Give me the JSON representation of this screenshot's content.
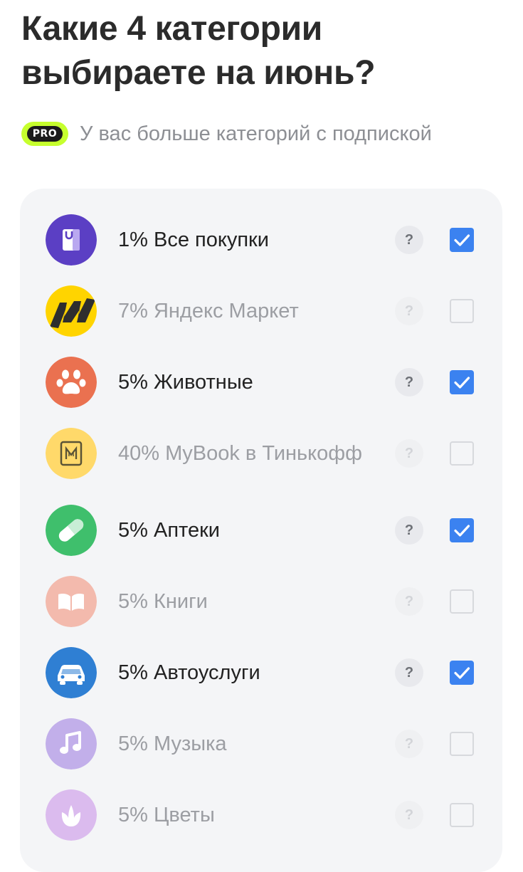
{
  "header": {
    "title": "Какие 4 категории выбираете на июнь?",
    "pro_badge": "PRO",
    "pro_text": "У вас больше категорий с подпиской"
  },
  "categories": [
    {
      "label": "1% Все покупки",
      "selected": true,
      "icon": "shopping-bag-icon",
      "color": "#5b3fc4"
    },
    {
      "label": "7% Яндекс Маркет",
      "selected": false,
      "icon": "yandex-market-icon",
      "color": "#ffd400"
    },
    {
      "label": "5% Животные",
      "selected": true,
      "icon": "paw-icon",
      "color": "#ea7150"
    },
    {
      "label": "40% MyBook в Тинькофф",
      "selected": false,
      "icon": "mybook-icon",
      "color": "#ffd96a"
    },
    {
      "label": "5% Аптеки",
      "selected": true,
      "icon": "pill-icon",
      "color": "#3fbf6c"
    },
    {
      "label": "5% Книги",
      "selected": false,
      "icon": "book-icon",
      "color": "#f28064"
    },
    {
      "label": "5% Автоуслуги",
      "selected": true,
      "icon": "car-icon",
      "color": "#2f7fd3"
    },
    {
      "label": "5% Музыка",
      "selected": false,
      "icon": "music-note-icon",
      "color": "#8f69dd"
    },
    {
      "label": "5% Цветы",
      "selected": false,
      "icon": "flower-icon",
      "color": "#c68ae8"
    }
  ],
  "help_symbol": "?"
}
